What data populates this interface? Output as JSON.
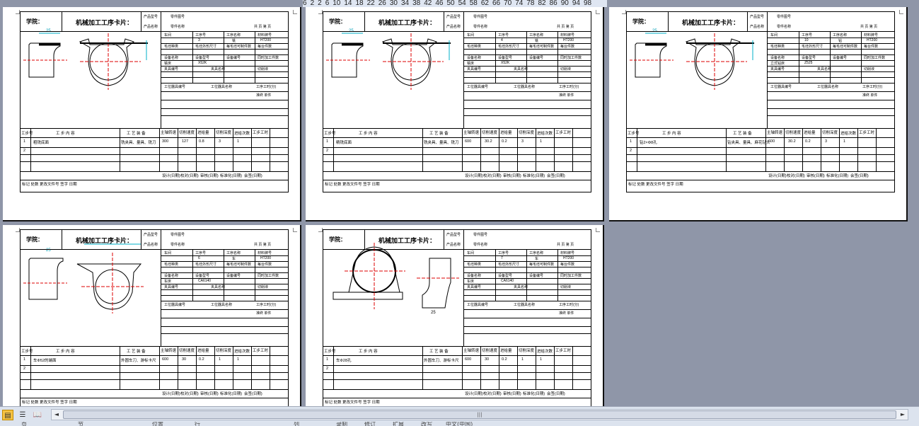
{
  "ruler": {
    "ticks": [
      "6",
      "2",
      "2",
      "6",
      "10",
      "14",
      "18",
      "22",
      "26",
      "30",
      "34",
      "38",
      "42",
      "46",
      "50",
      "54",
      "58",
      "62",
      "66",
      "70",
      "74",
      "78",
      "82",
      "86",
      "90",
      "94",
      "98"
    ]
  },
  "card_labels": {
    "school": "学院：",
    "title": "机械加工工序卡片：",
    "product_model": "产品型号",
    "part_drawing": "零件图号",
    "product_name": "产品名称",
    "part_name": "零件名称",
    "total_pages": "共",
    "page": "页",
    "page_no": "第",
    "workshop": "车间",
    "process_no": "工序号",
    "process_name": "工序名称",
    "material": "材料牌号",
    "blank_type": "毛坯种类",
    "blank_size": "毛坯外形尺寸",
    "pieces_per_blank": "每毛坯可制件数",
    "pieces_per_unit": "每台件数",
    "equipment_name": "设备名称",
    "equipment_model": "设备型号",
    "equipment_no": "设备编号",
    "simultaneous": "同时加工件数",
    "fixture_no": "夹具编号",
    "fixture_name": "夹具名称",
    "coolant": "切削液",
    "station_tool_no": "工位器具编号",
    "station_tool_name": "工位器具名称",
    "std_time": "工序工时(分)",
    "prep": "准终",
    "unit": "单件",
    "step_no": "工步号",
    "step_content": "工 步 内 容",
    "process_equipment": "工 艺 装 备",
    "spindle_speed": "主轴转速",
    "cut_speed": "切削速度",
    "feed": "进给量",
    "depth": "切削深度",
    "passes": "进给次数",
    "step_time": "工步工时",
    "mech": "机动",
    "aux": "辅助",
    "design": "设计(日期)",
    "review": "审核(日期)",
    "standardize": "标准化(日期)",
    "countersign": "会签(日期)",
    "proofread": "校对(日期)",
    "mark": "标记",
    "places": "处数",
    "change_doc": "更改文件号",
    "signature": "签字",
    "date": "日期",
    "material_val": "HT200"
  },
  "cards": [
    {
      "process_no": "3",
      "process_name": "铣",
      "equipment_model": "X52K",
      "equipment_name": "铣床",
      "step1": "粗铣底面",
      "tooling": "铣夹具、量具、铣刀",
      "speed": "300",
      "cutspeed": "127",
      "feed": "0.8",
      "depth": "3",
      "passes": "1",
      "dim": "25"
    },
    {
      "process_no": "4",
      "process_name": "铣",
      "equipment_model": "X52K",
      "equipment_name": "铣床",
      "step1": "精铣底面",
      "tooling": "铣夹具、量具、铣刀",
      "speed": "600",
      "cutspeed": "30.2",
      "feed": "0.2",
      "depth": "3",
      "passes": "1",
      "dim": "25"
    },
    {
      "process_no": "10",
      "process_name": "钻",
      "equipment_model": "Z525",
      "equipment_name": "立式钻床",
      "step1": "钻2×Φ8孔",
      "tooling": "钻夹具、量具、麻花钻头",
      "speed": "600",
      "cutspeed": "30.2",
      "feed": "0.2",
      "depth": "3",
      "passes": "1",
      "dim": "25"
    },
    {
      "process_no": "6",
      "process_name": "车",
      "equipment_model": "CA6140",
      "equipment_name": "车床",
      "step1": "车Φ52的端面",
      "tooling": "外圆车刀、游标卡尺",
      "speed": "600",
      "cutspeed": "30",
      "feed": "0.2",
      "depth": "1",
      "passes": "1",
      "dim": "25"
    },
    {
      "process_no": "7",
      "process_name": "车",
      "equipment_model": "CA6140",
      "equipment_name": "车床",
      "step1": "车Φ28孔",
      "tooling": "外圆车刀、游标卡尺",
      "speed": "600",
      "cutspeed": "30",
      "feed": "0.2",
      "depth": "1",
      "passes": "1",
      "dim": "25"
    }
  ],
  "statusbar": {
    "view_normal": "▤",
    "view_outline": "☰",
    "view_read": "📖",
    "scroll_left": "◄",
    "scroll_right": "►",
    "thumb_grip": "|||",
    "text_items": [
      "页",
      "节",
      "位置",
      "行",
      "列",
      "录制",
      "修订",
      "扩展",
      "改写",
      "中文(中国)"
    ]
  }
}
